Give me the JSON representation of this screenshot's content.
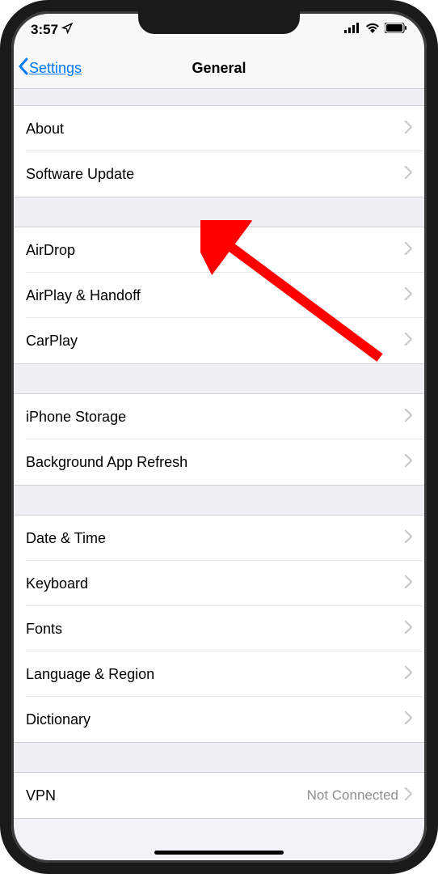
{
  "status": {
    "time": "3:57",
    "location_icon": "location-arrow-icon"
  },
  "nav": {
    "back_label": "Settings",
    "title": "General"
  },
  "sections": [
    {
      "items": [
        {
          "key": "about",
          "label": "About"
        },
        {
          "key": "software-update",
          "label": "Software Update"
        }
      ]
    },
    {
      "items": [
        {
          "key": "airdrop",
          "label": "AirDrop"
        },
        {
          "key": "airplay-handoff",
          "label": "AirPlay & Handoff"
        },
        {
          "key": "carplay",
          "label": "CarPlay"
        }
      ]
    },
    {
      "items": [
        {
          "key": "iphone-storage",
          "label": "iPhone Storage"
        },
        {
          "key": "background-app-refresh",
          "label": "Background App Refresh"
        }
      ]
    },
    {
      "items": [
        {
          "key": "date-time",
          "label": "Date & Time"
        },
        {
          "key": "keyboard",
          "label": "Keyboard"
        },
        {
          "key": "fonts",
          "label": "Fonts"
        },
        {
          "key": "language-region",
          "label": "Language & Region"
        },
        {
          "key": "dictionary",
          "label": "Dictionary"
        }
      ]
    },
    {
      "items": [
        {
          "key": "vpn",
          "label": "VPN",
          "value": "Not Connected"
        }
      ]
    }
  ],
  "annotation": {
    "arrow_color": "#ff0000"
  }
}
